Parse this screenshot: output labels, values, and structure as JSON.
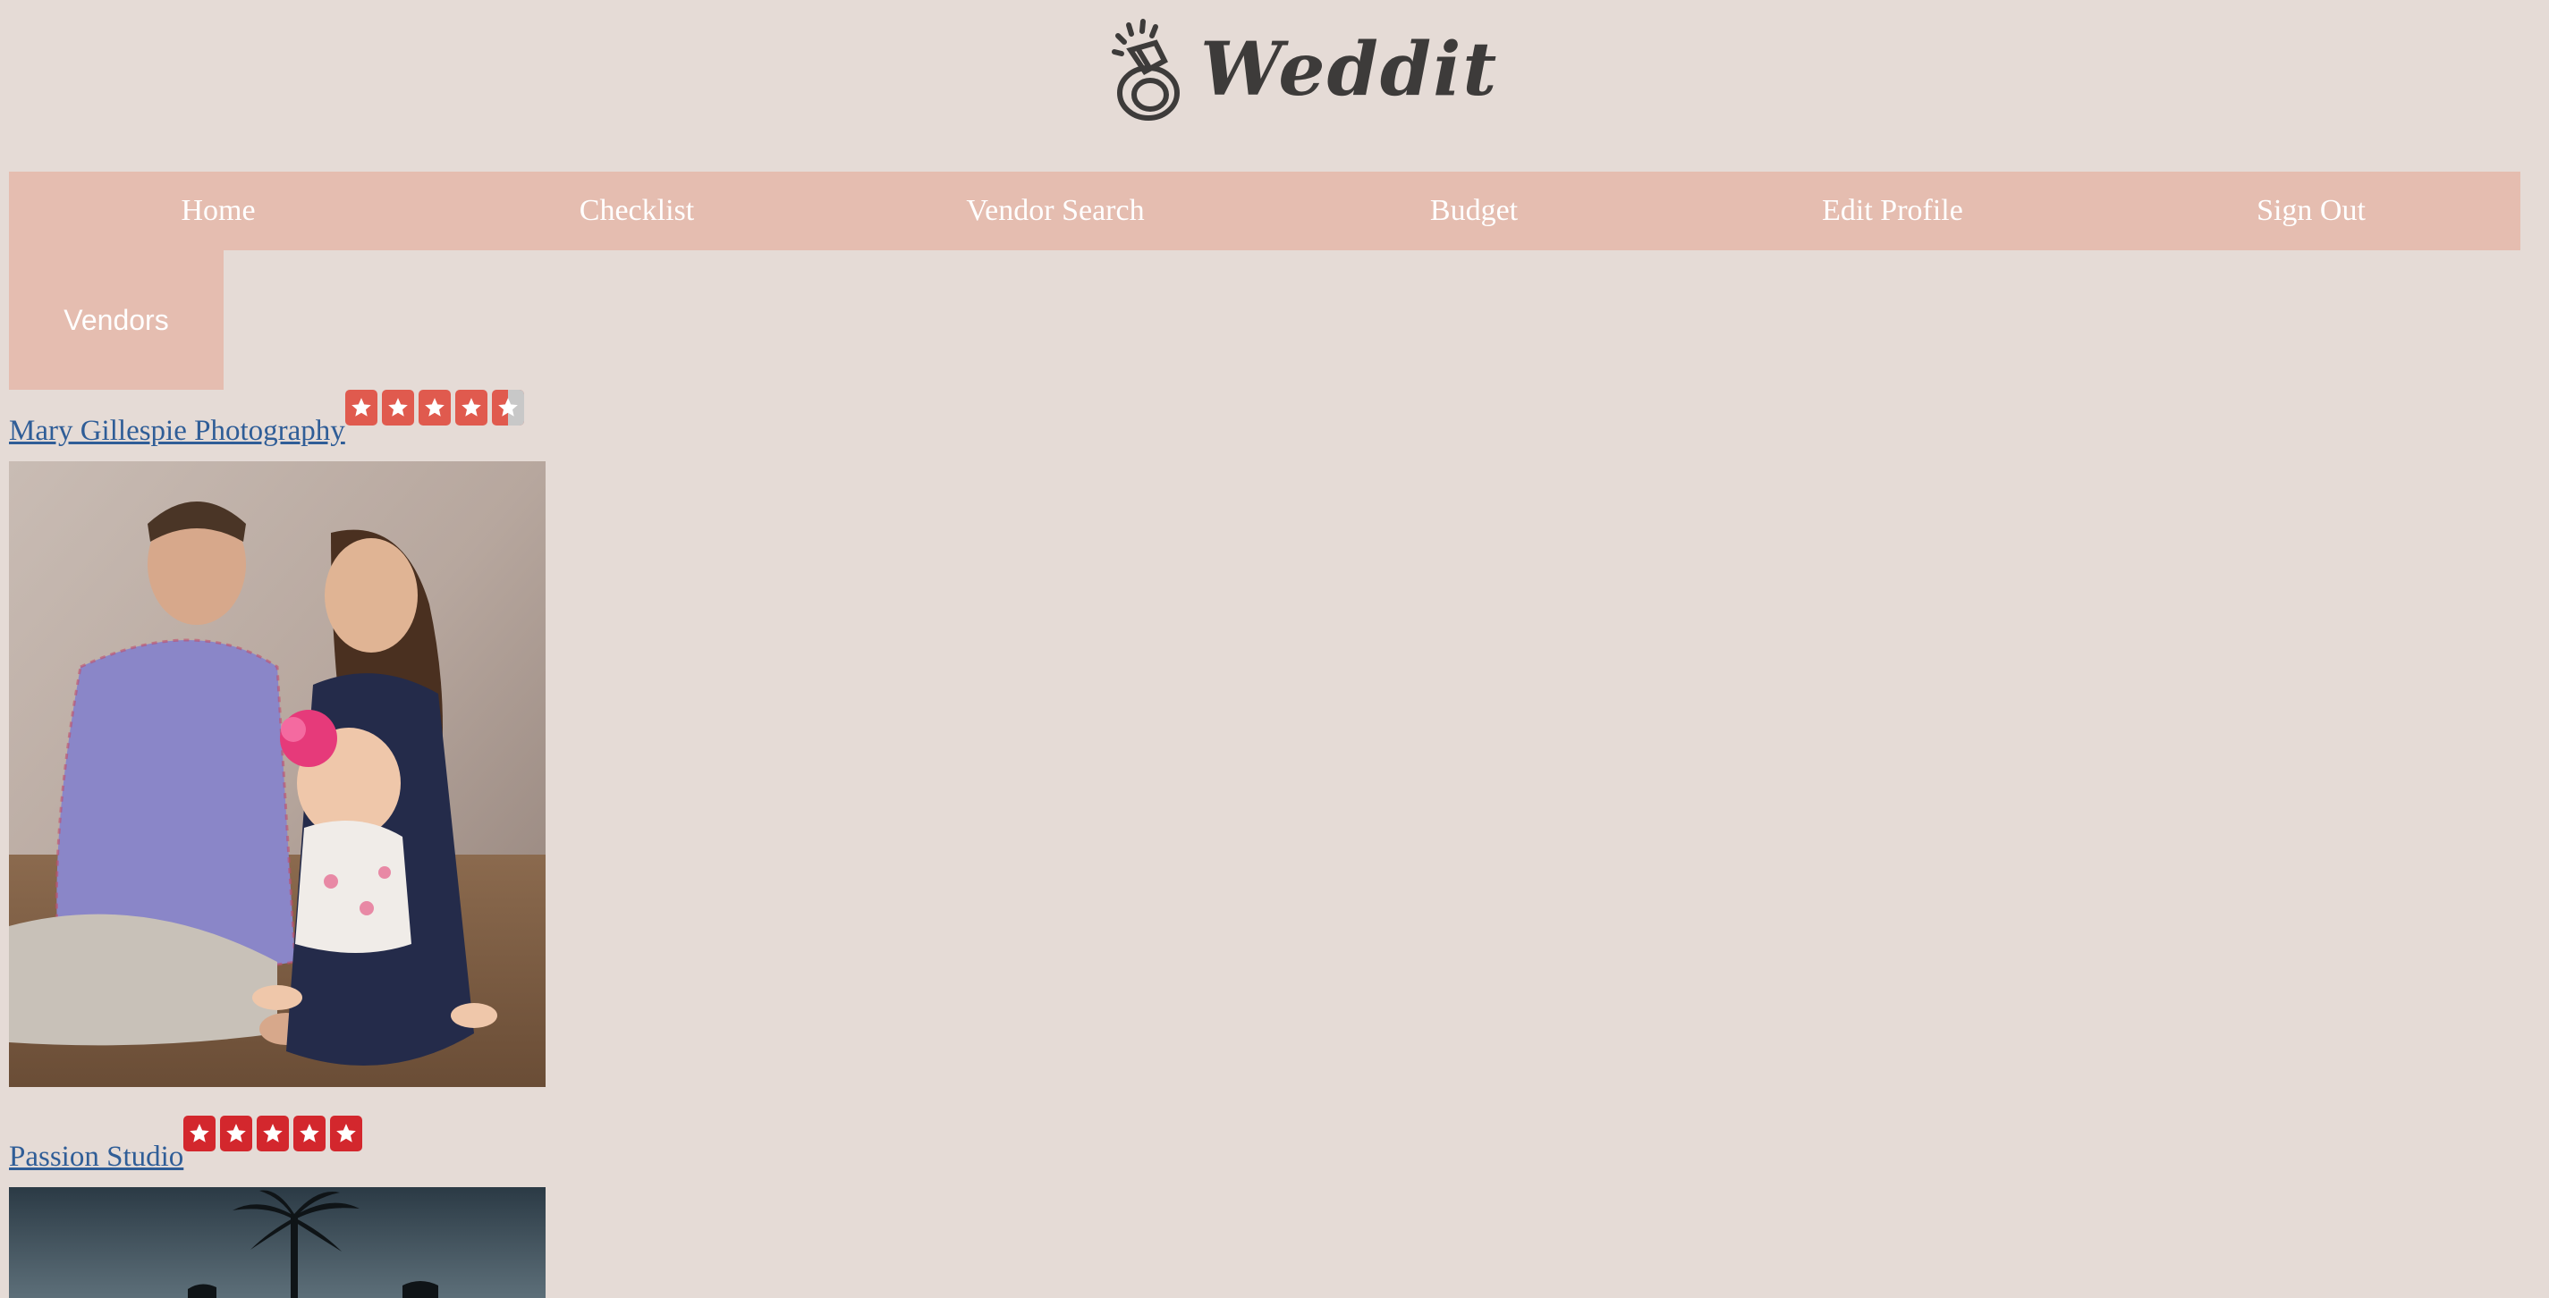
{
  "app": {
    "brand_name": "Weddit",
    "brand_color": "#3d3b3a",
    "background_color": "#e5dbd6",
    "nav_color": "#e5bdb0",
    "star_color_primary": "#e05a4e",
    "star_color_full": "#d3272d"
  },
  "nav": {
    "items": [
      {
        "label": "Home"
      },
      {
        "label": "Checklist"
      },
      {
        "label": "Vendor Search"
      },
      {
        "label": "Budget"
      },
      {
        "label": "Edit Profile"
      },
      {
        "label": "Sign Out"
      }
    ]
  },
  "vendors_tab": {
    "label": "Vendors"
  },
  "vendors": [
    {
      "name": "Mary Gillespie Photography",
      "rating": 4.5,
      "photo_icon": "family-portrait-photo"
    },
    {
      "name": "Passion Studio",
      "rating": 5,
      "photo_icon": "palm-tree-night-photo"
    }
  ]
}
